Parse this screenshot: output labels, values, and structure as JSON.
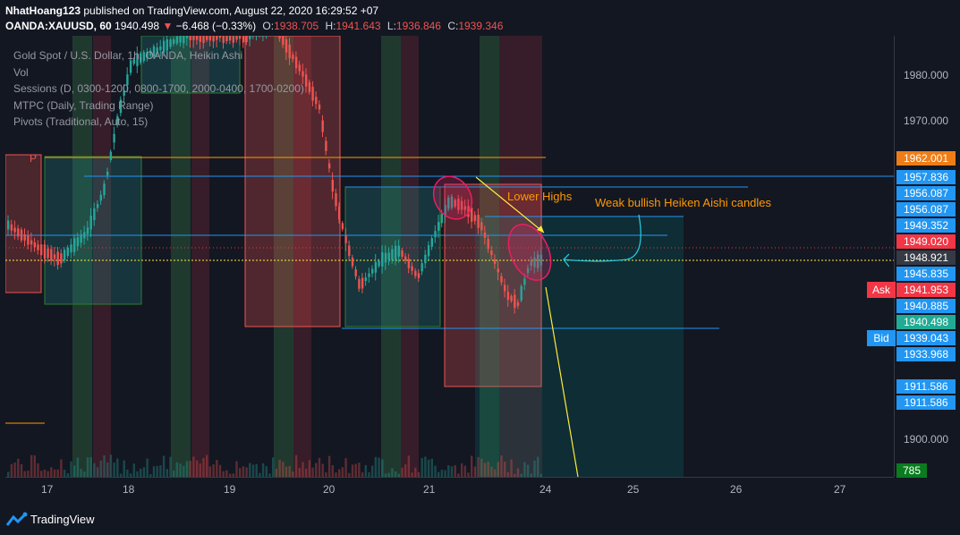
{
  "header": {
    "publisher_user": "NhatHoang123",
    "publisher_rest": " published on TradingView.com, August 22, 2020 16:29:52 +07",
    "symbol": "OANDA:XAUUSD, 60",
    "last": "1940.498",
    "change_arrow": "▼",
    "change": "−6.468 (−0.33%)",
    "o_label": "O:",
    "o_value": "1938.705",
    "h_label": "H:",
    "h_value": "1941.643",
    "l_label": "L:",
    "l_value": "1936.846",
    "c_label": "C:",
    "c_value": "1939.346"
  },
  "legend": {
    "title": "Gold Spot / U.S. Dollar, 1h, OANDA, Heikin Ashi",
    "vol": "Vol",
    "sessions": "Sessions (D, 0300-1200, 0800-1700, 2000-0400, 1700-0200)",
    "mtpc": "MTPC (Daily, Trading Range)",
    "pivots": "Pivots (Traditional, Auto, 15)"
  },
  "pivot_marker": "P",
  "annotations": {
    "lower_highs": "Lower Highs",
    "weak_bullish": "Weak bullish Heiken Aishi candles"
  },
  "price_axis": {
    "ticks": [
      "1980.000",
      "1970.000",
      "1900.000"
    ],
    "labels": [
      {
        "text": "1962.001",
        "color": "#ef7d17"
      },
      {
        "text": "1957.836",
        "color": "#2196f3"
      },
      {
        "text": "1956.087",
        "color": "#2196f3"
      },
      {
        "text": "1956.087",
        "color": "#2196f3"
      },
      {
        "text": "1949.352",
        "color": "#2196f3"
      },
      {
        "text": "1949.020",
        "color": "#f23645"
      },
      {
        "text": "1948.921",
        "color": "#363a45"
      },
      {
        "text": "1945.835",
        "color": "#2196f3"
      },
      {
        "text": "1941.953",
        "color": "#f23645"
      },
      {
        "text": "1940.885",
        "color": "#2196f3"
      },
      {
        "text": "1940.498",
        "color": "#22ab94"
      },
      {
        "text": "1939.043",
        "color": "#2196f3"
      },
      {
        "text": "1933.968",
        "color": "#2196f3"
      },
      {
        "text": "1911.586",
        "color": "#2196f3"
      },
      {
        "text": "1911.586",
        "color": "#2196f3"
      },
      {
        "text": "785",
        "color": "#0a7c1f"
      }
    ],
    "ask_label": "Ask",
    "bid_label": "Bid"
  },
  "time_axis": [
    "17",
    "18",
    "19",
    "20",
    "21",
    "24",
    "25",
    "26",
    "27"
  ],
  "footer": {
    "brand": "TradingView"
  },
  "colors": {
    "bull": "#26a69a",
    "bear": "#ef5350",
    "accent_orange": "#ff9800",
    "accent_blue": "#2196f3",
    "annotation_yellow": "#ffeb3b",
    "annotation_pink": "#e91e63",
    "annotation_teal": "#26c6da"
  }
}
